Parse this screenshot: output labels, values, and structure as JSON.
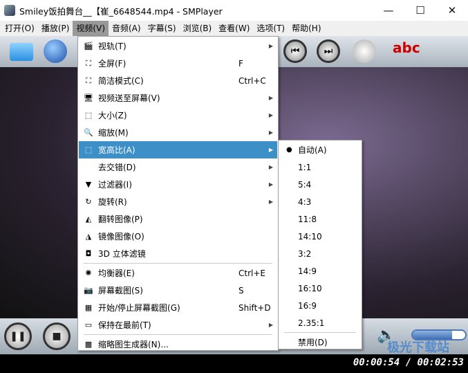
{
  "window": {
    "title": "Smiley饭拍舞台__【崔_6648544.mp4 - SMPlayer",
    "minimize": "—",
    "maximize": "☐",
    "close": "✕"
  },
  "menubar": [
    "打开(O)",
    "播放(P)",
    "视频(V)",
    "音频(A)",
    "字幕(S)",
    "浏览(B)",
    "查看(W)",
    "选项(T)",
    "帮助(H)"
  ],
  "video_menu": [
    {
      "label": "视轨(T)",
      "icon": "film-icon",
      "submenu": true
    },
    {
      "label": "全屏(F)",
      "icon": "fullscreen-icon",
      "shortcut": "F"
    },
    {
      "label": "简洁模式(C)",
      "icon": "compact-icon",
      "shortcut": "Ctrl+C"
    },
    {
      "label": "视频送至屏幕(V)",
      "icon": "monitor-icon",
      "submenu": true
    },
    {
      "label": "大小(Z)",
      "icon": "size-icon",
      "submenu": true
    },
    {
      "label": "缩放(M)",
      "icon": "zoom-icon",
      "submenu": true
    },
    {
      "label": "宽高比(A)",
      "icon": "aspect-icon",
      "submenu": true,
      "highlighted": true
    },
    {
      "label": "去交错(D)",
      "icon": "",
      "submenu": true
    },
    {
      "label": "过滤器(I)",
      "icon": "filter-icon",
      "submenu": true
    },
    {
      "label": "旋转(R)",
      "icon": "rotate-icon",
      "submenu": true
    },
    {
      "label": "翻转图像(P)",
      "icon": "flip-icon"
    },
    {
      "label": "镜像图像(O)",
      "icon": "mirror-icon"
    },
    {
      "label": "3D 立体滤镜",
      "icon": "3d-glasses-icon"
    },
    {
      "label": "均衡器(E)",
      "icon": "equalizer-icon",
      "shortcut": "Ctrl+E"
    },
    {
      "label": "屏幕截图(S)",
      "icon": "camera-icon",
      "shortcut": "S"
    },
    {
      "label": "开始/停止屏幕截图(G)",
      "icon": "screenshots-icon",
      "shortcut": "Shift+D"
    },
    {
      "label": "保持在最前(T)",
      "icon": "ontop-icon",
      "submenu": true
    },
    {
      "label": "缩略图生成器(N)...",
      "icon": "thumbnail-icon"
    }
  ],
  "aspect_submenu": {
    "items": [
      "自动(A)",
      "1:1",
      "5:4",
      "4:3",
      "11:8",
      "14:10",
      "3:2",
      "14:9",
      "16:10",
      "16:9",
      "2.35:1",
      "禁用(D)"
    ],
    "selected": "自动(A)"
  },
  "status": {
    "time": "00:00:54 / 00:02:53"
  },
  "volume": 0.75,
  "watermark": "极光下载站",
  "colors": {
    "highlight": "#3d8fc8"
  }
}
